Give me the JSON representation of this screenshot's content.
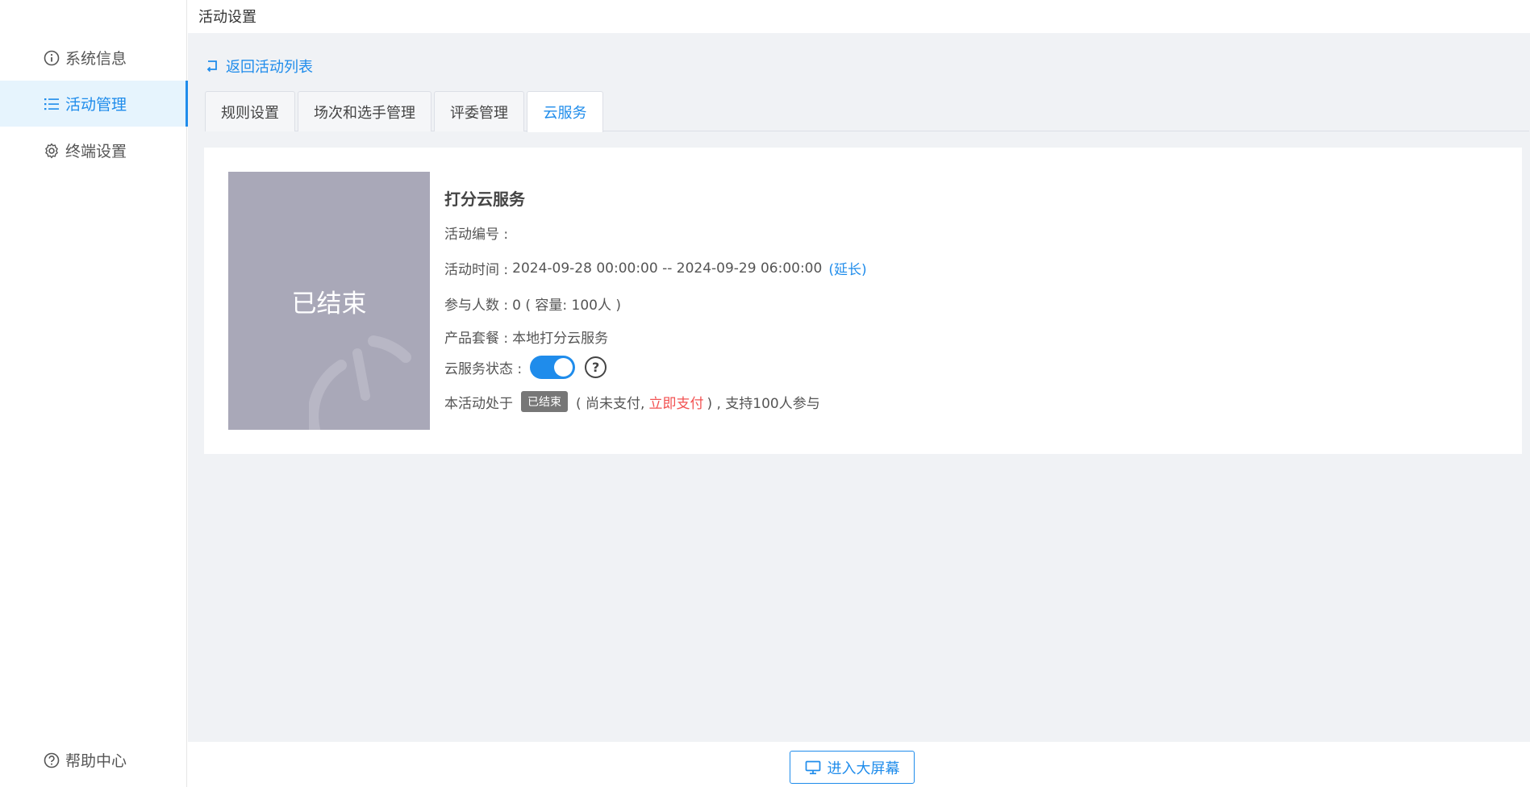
{
  "sidebar": {
    "items": [
      {
        "label": "系统信息",
        "icon": "info-icon"
      },
      {
        "label": "活动管理",
        "icon": "list-icon"
      },
      {
        "label": "终端设置",
        "icon": "gear-icon"
      }
    ],
    "help": {
      "label": "帮助中心",
      "icon": "question-icon"
    }
  },
  "header": {
    "title": "活动设置"
  },
  "back_link": {
    "label": "返回活动列表"
  },
  "tabs": [
    {
      "label": "规则设置"
    },
    {
      "label": "场次和选手管理"
    },
    {
      "label": "评委管理"
    },
    {
      "label": "云服务"
    }
  ],
  "service": {
    "poster_status": "已结束",
    "title": "打分云服务",
    "activity_id_label": "活动编号 :",
    "activity_time_label": "活动时间 :",
    "activity_time_value": "2024-09-28 00:00:00 -- 2024-09-29 06:00:00",
    "extend_label": "(延长)",
    "participants_label": "参与人数 :",
    "participants_value": "0 ( 容量: 100人 )",
    "package_label": "产品套餐 :",
    "package_value": "本地打分云服务",
    "cloud_status_label": "云服务状态 :",
    "cloud_status_on": true,
    "state_prefix": "本活动处于",
    "state_badge": "已结束",
    "unpaid_text": "( 尚未支付,",
    "pay_label": "立即支付",
    "state_suffix": ") , 支持100人参与"
  },
  "bottom": {
    "enter_screen_label": "进入大屏幕"
  },
  "colors": {
    "accent": "#1f8ceb",
    "danger": "#f25252",
    "poster": "#a9a8b8"
  }
}
